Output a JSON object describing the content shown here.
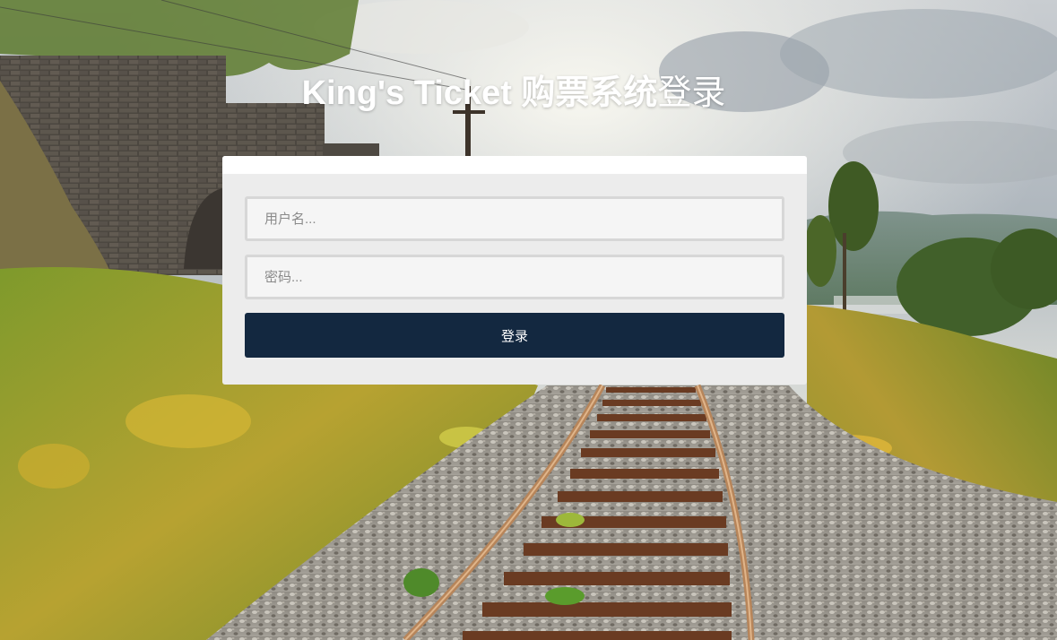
{
  "page": {
    "title_bold": "King's Ticket 购票系统",
    "title_light": "登录"
  },
  "login_form": {
    "username_placeholder": "用户名...",
    "username_value": "",
    "password_placeholder": "密码...",
    "password_value": "",
    "submit_label": "登录"
  },
  "colors": {
    "button": "#132840",
    "card": "#ececec",
    "field_border": "#d7d7d7"
  }
}
